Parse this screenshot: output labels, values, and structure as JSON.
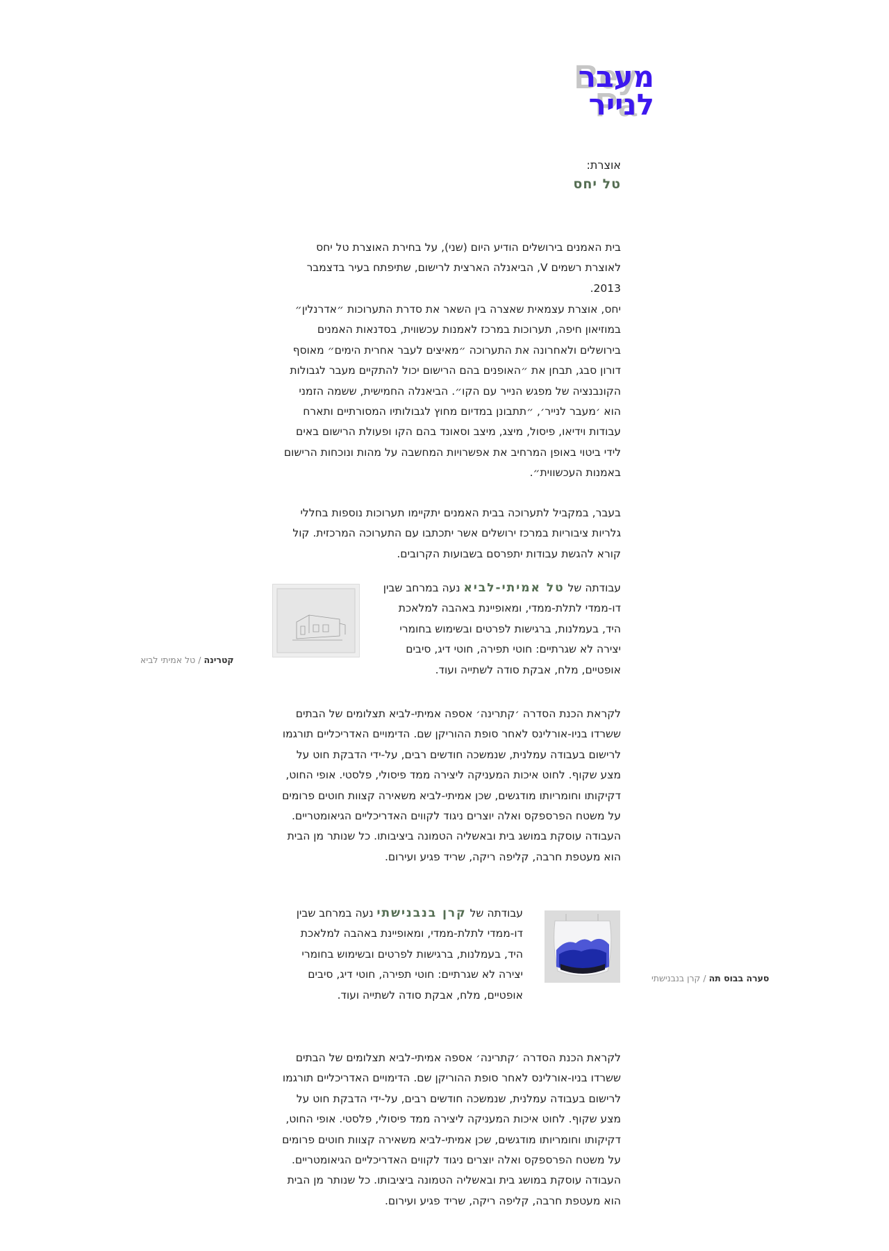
{
  "logo": {
    "hebrew_line1": "מעבר",
    "hebrew_line2": "לנייר",
    "english_line1": "Bey",
    "english_line2": "Pa",
    "colors": {
      "hebrew": "#3d18ef",
      "english": "#c6c6c6"
    }
  },
  "curator": {
    "label": "אוצרת:",
    "name": "טל יחס"
  },
  "intro": {
    "p1": "בית האמנים בירושלים הודיע היום (שני), על בחירת האוצרת טל יחס לאוצרת רשמים V, הביאנלה הארצית לרישום, שתיפתח בעיר בדצמבר 2013.",
    "p2": "יחס, אוצרת עצמאית שאצרה בין השאר את סדרת התערוכות ״אדרנלין״ במוזיאון חיפה, תערוכות במרכז לאמנות עכשווית, בסדנאות האמנים בירושלים ולאחרונה את התערוכה ״מאיצים לעבר אחרית הימים״ מאוסף דורון סבג, תבחן את ״האופנים בהם הרישום יכול להתקיים מעבר לגבולות הקונבנציה של מפגש הנייר עם הקו״. הביאנלה החמישית, ששמה הזמני הוא ׳מעבר לנייר׳, ״תתבונן במדיום מחוץ לגבולותיו המסורתיים ותארח עבודות וידיאו, פיסול, מיצג, מיצב וסאונד בהם הקו ופעולת הרישום באים לידי ביטוי באופן המרחיב את אפשרויות המחשבה על מהות ונוכחות הרישום באמנות העכשווית״.",
    "p3": "בעבר, במקביל לתערוכה בבית האמנים יתקיימו תערוכות נוספות בחללי גלריות ציבוריות במרכז ירושלים אשר יתכתבו עם התערוכה המרכזית. קול קורא להגשת עבודות יתפרסם בשבועות הקרובים."
  },
  "artwork1": {
    "prefix": "עבודתה של",
    "artist": "טל אמיתי-לביא",
    "text": "נעה במרחב שבין דו-ממדי לתלת-ממדי, ומאופיינת באהבה למלאכת היד, בעמלנות, ברגישות לפרטים ובשימוש בחומרי יצירה לא שגרתיים: חוטי תפירה, חוטי דיג, סיבים אופטיים, מלח, אבקת סודה לשתייה ועוד.",
    "caption_title": "קטרינה",
    "caption_artist": "טל אמיתי לביא",
    "description": "לקראת הכנת הסדרה ׳קתרינה׳ אספה אמיתי-לביא תצלומים של הבתים ששרדו בניו-אורלינס לאחר סופת ההוריקן שם. הדימויים האדריכליים תורגמו לרישום בעבודה עמלנית, שנמשכה חודשים רבים, על-ידי הדבקת חוט על מצע שקוף. לחוט איכות המעניקה ליצירה ממד פיסולי, פלסטי. אופי החוט, דקיקותו וחומריותו מודגשים, שכן אמיתי-לביא משאירה קצוות חוטים פרומים על משטח הפרספקס ואלה יוצרים ניגוד לקווים האדריכליים הגיאומטריים. העבודה עוסקת במושג בית ובאשליה הטמונה ביציבותו. כל שנותר מן הבית הוא מעטפת חרבה, קליפה ריקה, שריד פגיע ועירום."
  },
  "artwork2": {
    "prefix": "עבודתה של",
    "artist": "קרן בנבנישתי",
    "text": "נעה במרחב שבין דו-ממדי לתלת-ממדי, ומאופיינת באהבה למלאכת היד, בעמלנות, ברגישות  לפרטים ובשימוש בחומרי יצירה לא שגרתיים: חוטי תפירה, חוטי דיג, סיבים אופטיים, מלח, אבקת סודה לשתייה ועוד.",
    "caption_title": "סערה בבוס תה",
    "caption_artist": "קרן בנבנישתי",
    "description": "לקראת הכנת הסדרה ׳קתרינה׳ אספה אמיתי-לביא תצלומים של הבתים ששרדו בניו-אורלינס לאחר סופת ההוריקן שם. הדימויים האדריכליים תורגמו לרישום בעבודה עמלנית, שנמשכה חודשים רבים, על-ידי הדבקת חוט על מצע שקוף. לחוט איכות המעניקה ליצירה ממד פיסולי, פלסטי. אופי החוט, דקיקותו וחומריותו מודגשים, שכן אמיתי-לביא משאירה קצוות חוטים פרומים על משטח הפרספקס ואלה יוצרים ניגוד לקווים האדריכליים הגיאומטריים. העבודה עוסקת במושג בית ובאשליה הטמונה ביציבותו. כל שנותר מן הבית הוא מעטפת חרבה, קליפה ריקה, שריד פגיע ועירום."
  },
  "caption_separator": "/"
}
